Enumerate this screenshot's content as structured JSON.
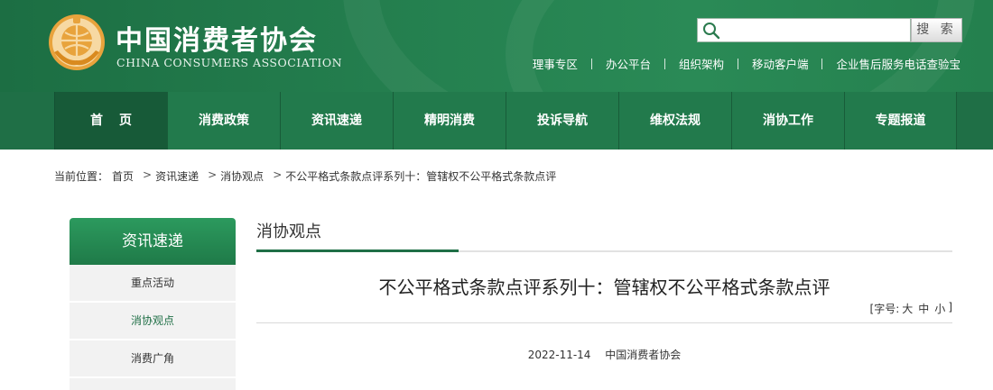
{
  "brand": {
    "name_cn": "中国消费者协会",
    "name_en": "CHINA CONSUMERS ASSOCIATION",
    "primary_color": "#1f6f46",
    "accent_color": "#e8a33c"
  },
  "search": {
    "placeholder": "",
    "button_label": "搜 索"
  },
  "top_links": [
    "理事专区",
    "办公平台",
    "组织架构",
    "移动客户端",
    "企业售后服务电话查验宝"
  ],
  "nav": [
    "首页",
    "消费政策",
    "资讯速递",
    "精明消费",
    "投诉导航",
    "维权法规",
    "消协工作",
    "专题报道"
  ],
  "breadcrumb": {
    "prefix": "当前位置：",
    "items": [
      "首页",
      "资讯速递",
      "消协观点",
      "不公平格式条款点评系列十：管辖权不公平格式条款点评"
    ]
  },
  "sidebar": {
    "title": "资讯速递",
    "items": [
      "重点活动",
      "消协观点",
      "消费广角"
    ],
    "active": "消协观点"
  },
  "main": {
    "section_title": "消协观点",
    "article_title": "不公平格式条款点评系列十：管辖权不公平格式条款点评",
    "font_size": {
      "prefix": "[字号:",
      "large": "大",
      "medium": "中",
      "small": "小",
      "suffix": "]"
    },
    "date": "2022-11-14",
    "source": "中国消费者协会"
  }
}
